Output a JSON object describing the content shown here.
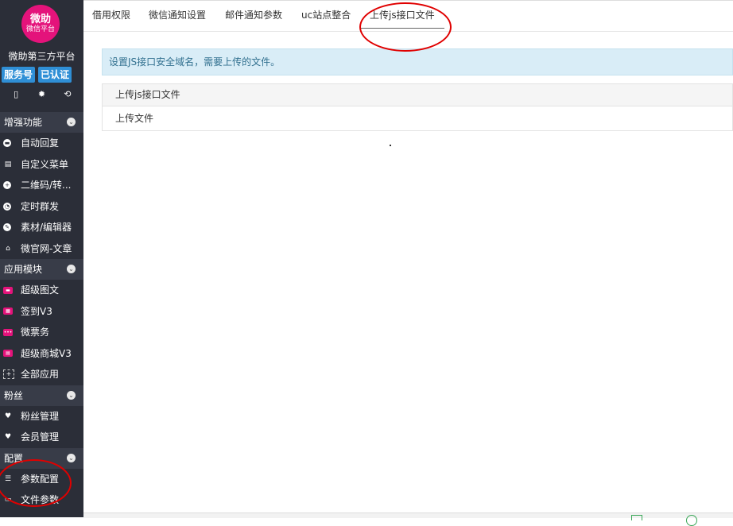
{
  "sidebar": {
    "logo_line1": "微助",
    "logo_line2": "微信平台",
    "platform_name": "微助第三方平台",
    "badges": [
      "服务号",
      "已认证"
    ],
    "tools": [
      "mobile-icon",
      "gear-icon",
      "refresh-icon"
    ],
    "sections": [
      {
        "title": "增强功能",
        "items": [
          {
            "label": "自动回复",
            "icon": "chat-bubble-icon"
          },
          {
            "label": "自定义菜单",
            "icon": "menu-doc-icon"
          },
          {
            "label": "二维码/转...",
            "icon": "plus-circle-icon"
          },
          {
            "label": "定时群发",
            "icon": "clock-icon"
          },
          {
            "label": "素材/编辑器",
            "icon": "pencil-icon"
          },
          {
            "label": "微官网-文章",
            "icon": "home-icon"
          }
        ]
      },
      {
        "title": "应用模块",
        "items": [
          {
            "label": "超级图文",
            "icon": "app-pink-icon"
          },
          {
            "label": "签到V3",
            "icon": "app-pink-icon"
          },
          {
            "label": "微票务",
            "icon": "app-pink-icon"
          },
          {
            "label": "超级商城V3",
            "icon": "app-pink-icon"
          },
          {
            "label": "全部应用",
            "icon": "grid-dashed-icon"
          }
        ]
      },
      {
        "title": "粉丝",
        "items": [
          {
            "label": "粉丝管理",
            "icon": "heart-icon"
          },
          {
            "label": "会员管理",
            "icon": "heart-icon"
          }
        ]
      },
      {
        "title": "配置",
        "items": [
          {
            "label": "参数配置",
            "icon": "list-icon"
          },
          {
            "label": "文件参数",
            "icon": "file-icon"
          }
        ]
      }
    ]
  },
  "tabs": [
    {
      "label": "借用权限"
    },
    {
      "label": "微信通知设置"
    },
    {
      "label": "邮件通知参数"
    },
    {
      "label": "uc站点整合"
    },
    {
      "label": "上传js接口文件",
      "active": true
    }
  ],
  "content": {
    "alert_text": "设置JS接口安全域名，需要上传的文件。",
    "panel_title": "上传js接口文件",
    "upload_link": "上传文件"
  },
  "colors": {
    "sidebar_bg": "#2b2e38",
    "section_bg": "#383c48",
    "brand_pink": "#e4137b",
    "badge_blue": "#2f8fd6",
    "alert_bg": "#d9edf7",
    "annotation_red": "#e00000"
  }
}
